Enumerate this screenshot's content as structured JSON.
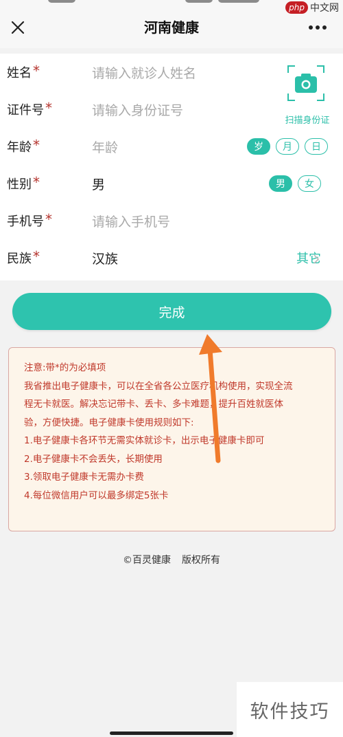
{
  "header": {
    "title": "河南健康",
    "watermark_php": "php",
    "watermark_cn": "中文网"
  },
  "form": {
    "rows": [
      {
        "label": "姓名",
        "required": "*",
        "value": "请输入就诊人姓名"
      },
      {
        "label": "证件号",
        "required": "*",
        "value": "请输入身份证号"
      },
      {
        "label": "年龄",
        "required": "*",
        "value": "年龄"
      },
      {
        "label": "性别",
        "required": "*",
        "value": "男"
      },
      {
        "label": "手机号",
        "required": "*",
        "value": "请输入手机号"
      },
      {
        "label": "民族",
        "required": "*",
        "value": "汉族"
      }
    ],
    "scan_label": "扫描身份证",
    "age_units": [
      "岁",
      "月",
      "日"
    ],
    "gender_options": [
      "男",
      "女"
    ],
    "ethnicity_other": "其它"
  },
  "done_label": "完成",
  "notice": {
    "lines": [
      "注意:带*的为必填项",
      "我省推出电子健康卡，可以在全省各公立医疗机构使用，实现全流",
      "程无卡就医。解决忘记带卡、丢卡、多卡难题，提升百姓就医体",
      "验，方便快捷。电子健康卡使用规则如下:",
      "1.电子健康卡各环节无需实体就诊卡，出示电子健康卡即可",
      "2.电子健康卡不会丢失，长期使用",
      "3.领取电子健康卡无需办卡费",
      "4.每位微信用户可以最多绑定5张卡"
    ]
  },
  "footer": {
    "copyright": "©百灵健康",
    "rights": "版权所有"
  },
  "watermark_bottom": "软件技巧",
  "colors": {
    "accent": "#2bbfa9",
    "required": "#b5352f",
    "notice_text": "#c0392b",
    "arrow": "#f07b2c"
  }
}
